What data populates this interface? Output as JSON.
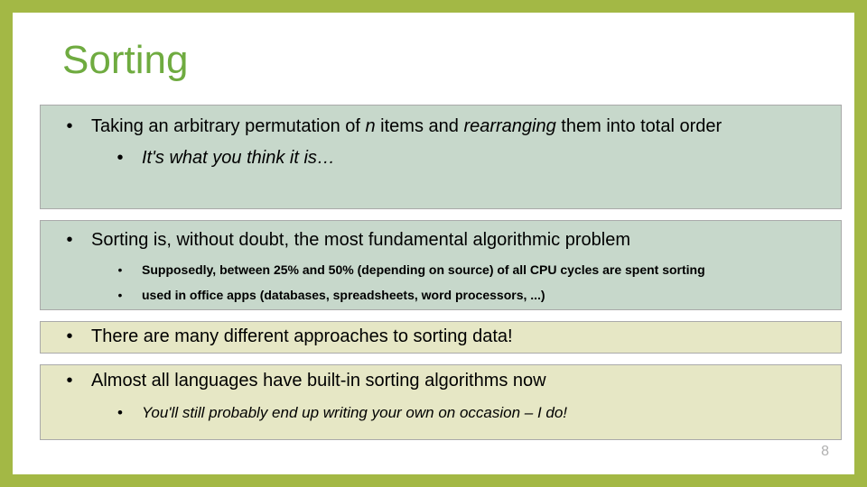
{
  "title": "Sorting",
  "block1": {
    "main_pre": "Taking an arbitrary permutation of ",
    "main_em1": "n",
    "main_mid": " items and ",
    "main_em2": "rearranging",
    "main_post": " them into total order",
    "sub1": "It's what you think it is…"
  },
  "block2": {
    "main": "Sorting is, without doubt, the most fundamental algorithmic problem",
    "sub1": "Supposedly, between 25% and 50% (depending on source) of all CPU cycles are spent sorting",
    "sub2": "used in office apps (databases, spreadsheets, word processors, ...)"
  },
  "block3": {
    "main": "There are many different approaches to sorting data!"
  },
  "block4": {
    "main": "Almost all languages have built-in sorting algorithms now",
    "sub1": "You'll still probably end up writing your own on occasion – I do!"
  },
  "bullet": "•",
  "pagenum": "8"
}
